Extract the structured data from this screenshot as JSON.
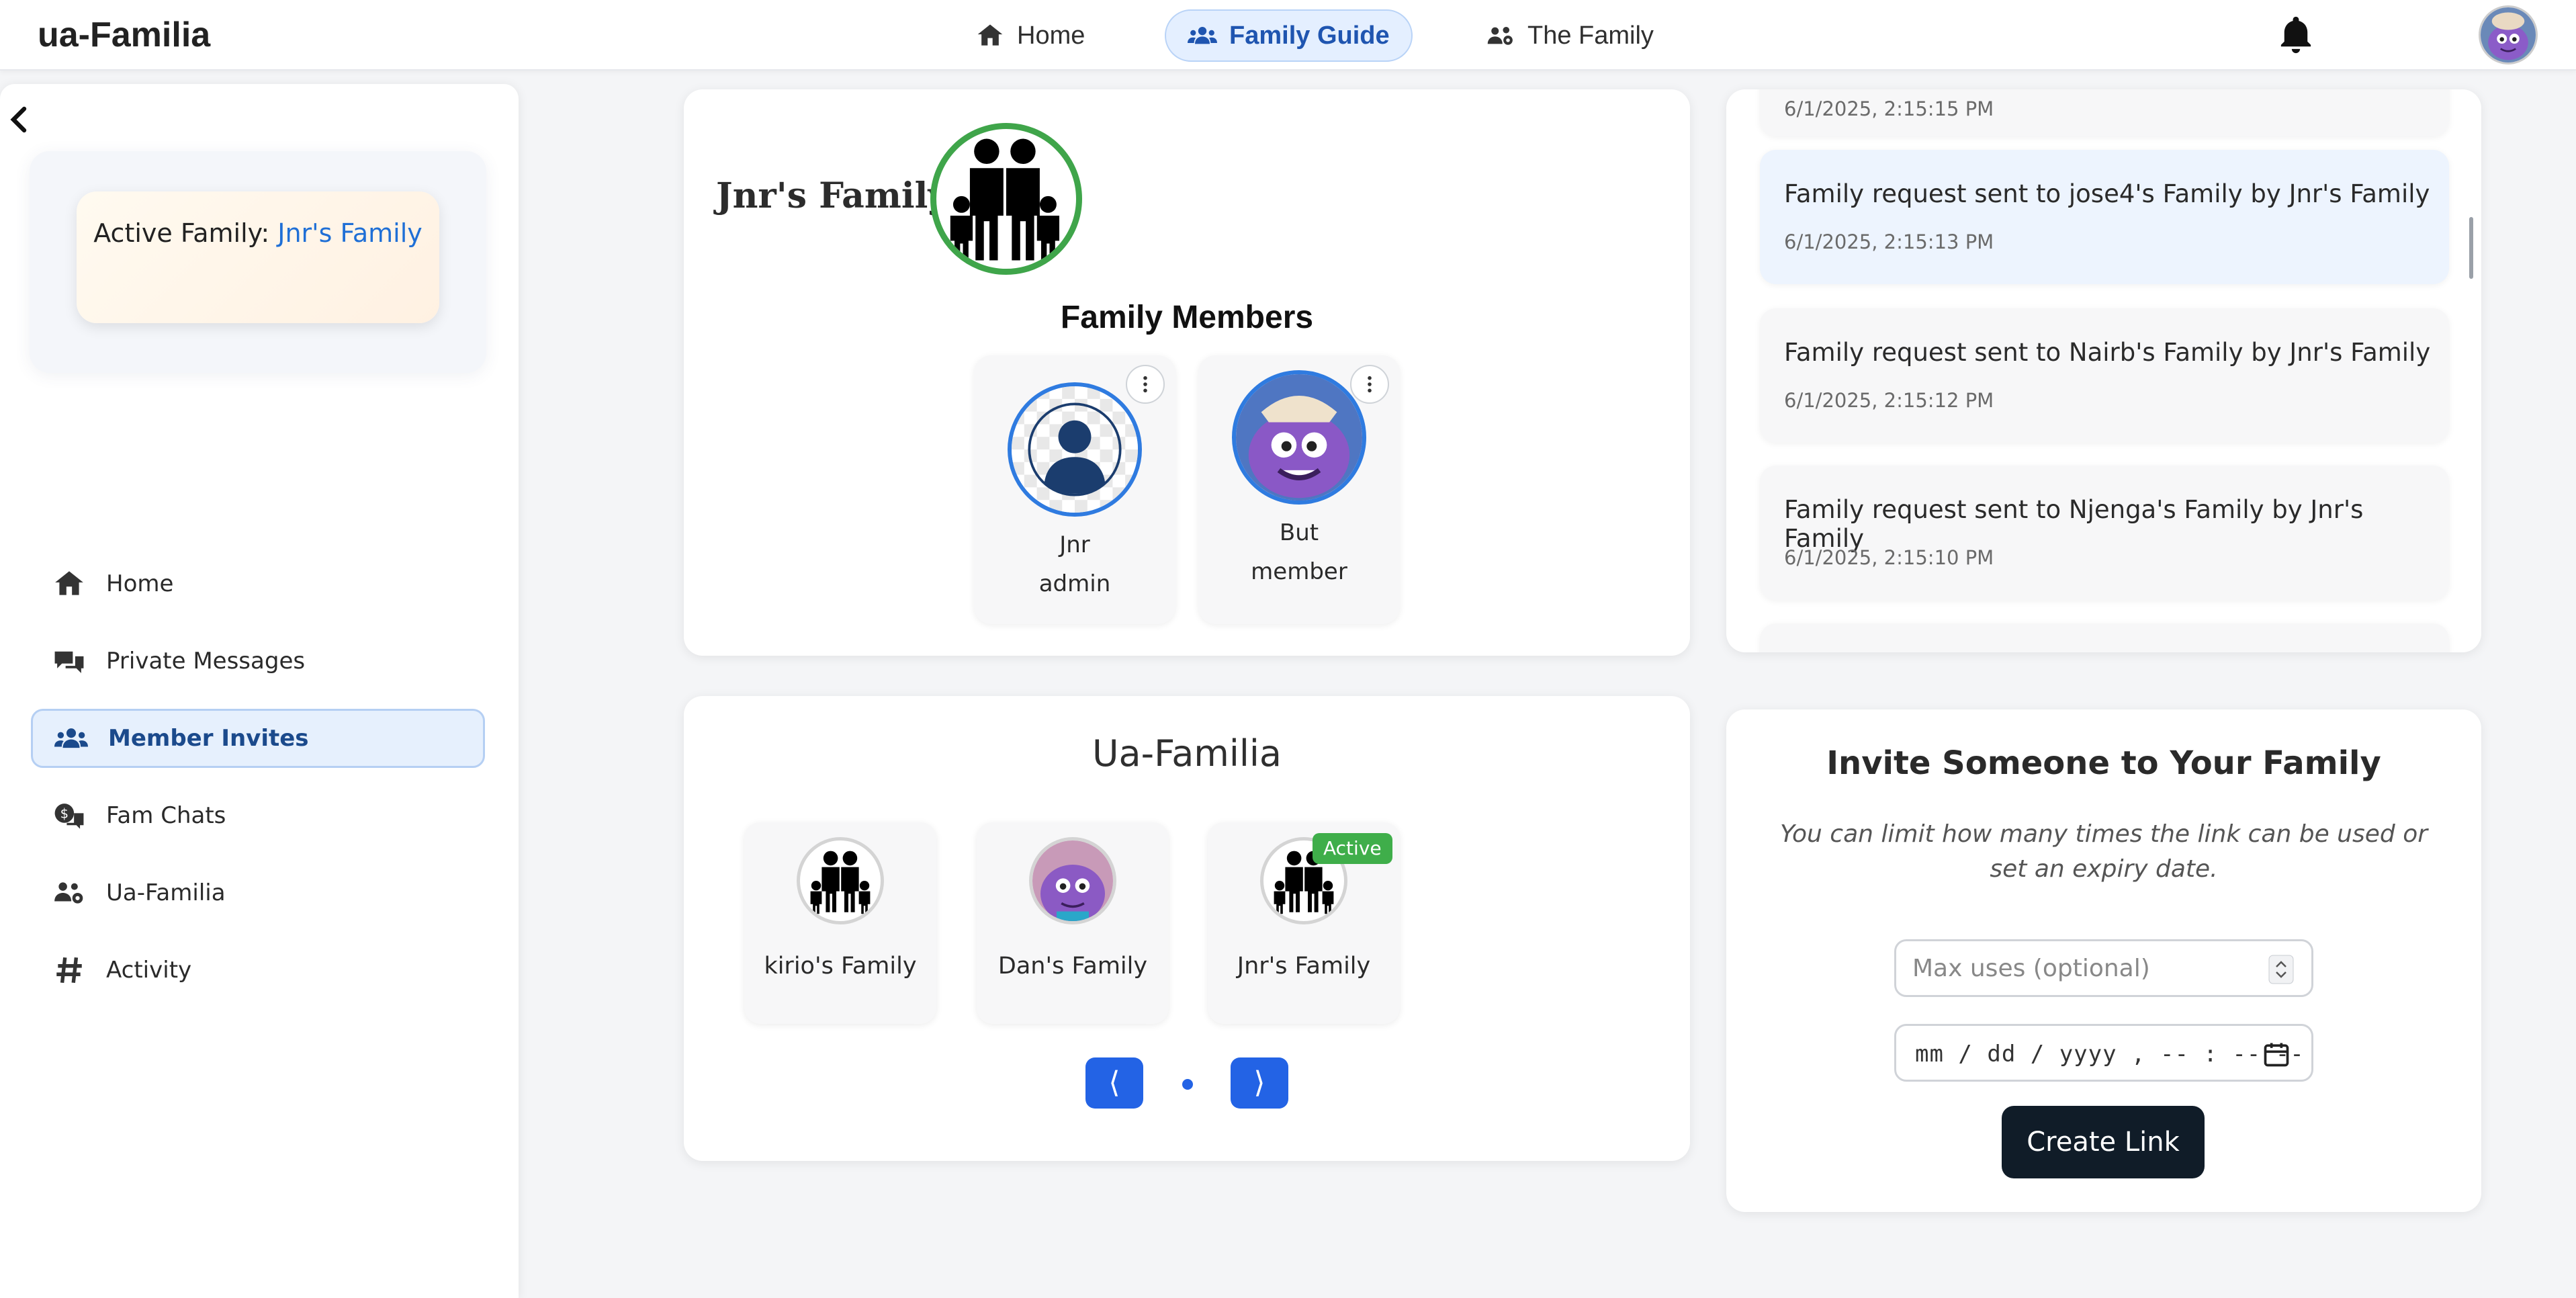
{
  "app": {
    "brand": "ua-Familia"
  },
  "topnav": {
    "items": [
      {
        "label": "Home",
        "icon": "home-icon",
        "active": false
      },
      {
        "label": "Family Guide",
        "icon": "users-icon",
        "active": true
      },
      {
        "label": "The Family",
        "icon": "family-gear-icon",
        "active": false
      }
    ],
    "notifications_icon": "bell-icon",
    "avatar_icon": "user-avatar"
  },
  "sidebar": {
    "active_family": {
      "label": "Active Family: ",
      "name": "Jnr's Family"
    },
    "items": [
      {
        "label": "Home",
        "icon": "home-icon"
      },
      {
        "label": "Private Messages",
        "icon": "comments-icon"
      },
      {
        "label": "Member Invites",
        "icon": "users-icon",
        "active": true
      },
      {
        "label": "Fam Chats",
        "icon": "money-chat-icon"
      },
      {
        "label": "Ua-Familia",
        "icon": "users-gear-icon"
      },
      {
        "label": "Activity",
        "icon": "hashtag-icon"
      }
    ]
  },
  "family_card": {
    "title": "Jnr's Family",
    "members_title": "Family Members",
    "members": [
      {
        "name": "Jnr",
        "role": "admin"
      },
      {
        "name": "But",
        "role": "member"
      }
    ]
  },
  "activity": {
    "items": [
      {
        "message": "",
        "time": "6/1/2025, 2:15:15 PM"
      },
      {
        "message": "Family request sent to jose4's Family by Jnr's Family",
        "time": "6/1/2025, 2:15:13 PM"
      },
      {
        "message": "Family request sent to Nairb's Family by Jnr's Family",
        "time": "6/1/2025, 2:15:12 PM"
      },
      {
        "message": "Family request sent to Njenga's Family by Jnr's Family",
        "time": "6/1/2025, 2:15:10 PM"
      }
    ]
  },
  "ua_familia": {
    "title": "Ua-Familia",
    "families": [
      {
        "name": "kirio's Family",
        "badge": ""
      },
      {
        "name": "Dan's Family",
        "badge": ""
      },
      {
        "name": "Jnr's Family",
        "badge": "Active"
      }
    ],
    "prev_label": "⟨",
    "next_label": "⟩"
  },
  "invite": {
    "title": "Invite Someone to Your Family",
    "subtitle": "You can limit how many times the link can be used or set an expiry date.",
    "max_uses_placeholder": "Max uses (optional)",
    "date_placeholder": "mm / dd / yyyy ,  -- : --  --",
    "button": "Create Link"
  },
  "colors": {
    "accent": "#2363e5",
    "active_green": "#3fae4a",
    "dark_button": "#101c28"
  }
}
